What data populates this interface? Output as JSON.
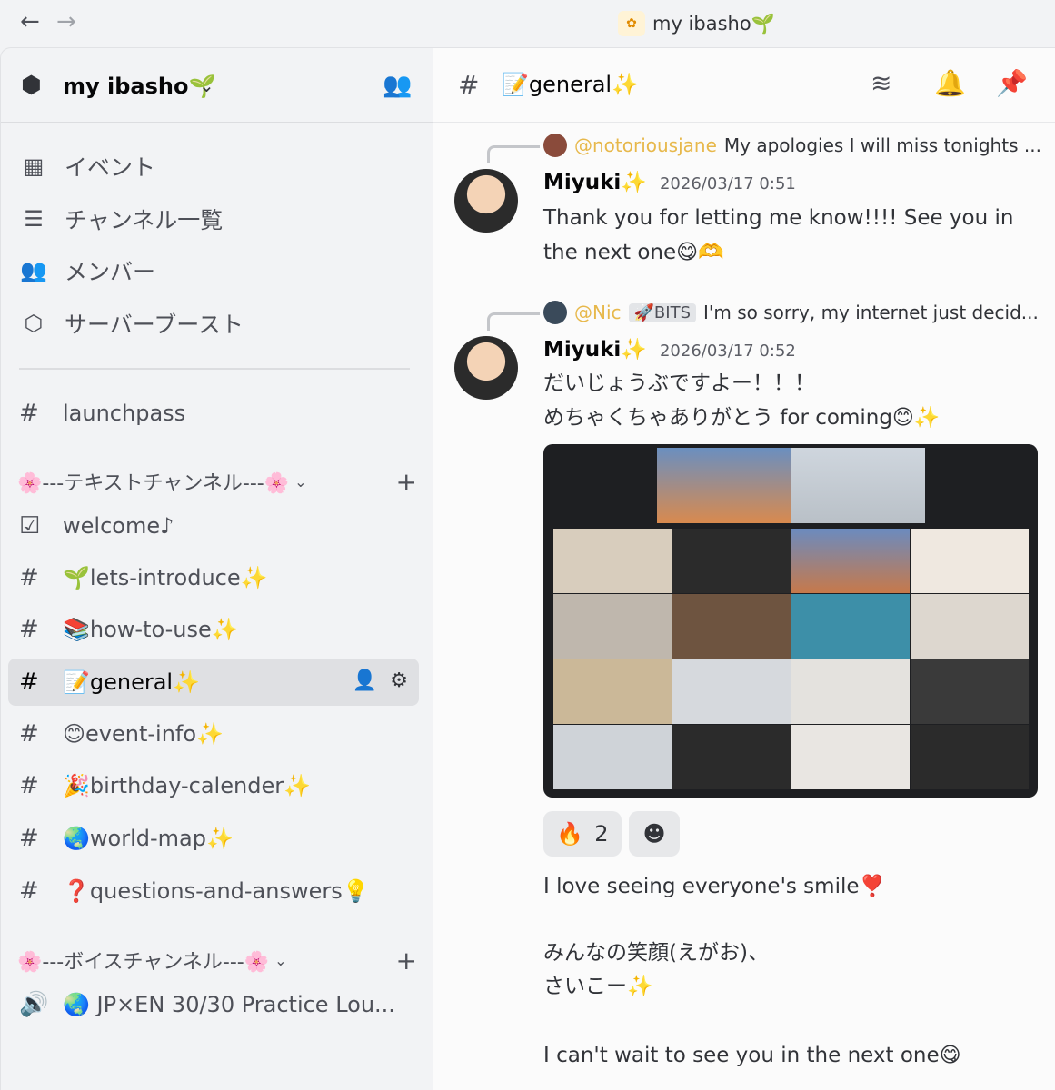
{
  "titlebar": {
    "back_icon": "arrow-left-icon",
    "forward_icon": "arrow-right-icon",
    "app_title": "my ibasho🌱",
    "logo_text": "ibasho"
  },
  "sidebar": {
    "server_name": "my ibasho🌱",
    "menu": [
      {
        "label": "イベント",
        "icon": "calendar-icon"
      },
      {
        "label": "チャンネル一覧",
        "icon": "channel-browse-icon"
      },
      {
        "label": "メンバー",
        "icon": "members-icon"
      },
      {
        "label": "サーバーブースト",
        "icon": "boost-icon"
      }
    ],
    "standalone_channel": "launchpass",
    "text_category": "🌸---テキストチャンネル---🌸",
    "text_channels": [
      {
        "label": "welcome♪",
        "icon": "rules-icon"
      },
      {
        "label": "🌱lets-introduce✨",
        "icon": "hash-lock-icon"
      },
      {
        "label": "📚how-to-use✨",
        "icon": "hash-lock-icon"
      },
      {
        "label": "📝general✨",
        "icon": "hash-lock-icon",
        "selected": true
      },
      {
        "label": "😊event-info✨",
        "icon": "hash-lock-icon"
      },
      {
        "label": "🎉birthday-calender✨",
        "icon": "hash-lock-icon"
      },
      {
        "label": "🌏world-map✨",
        "icon": "hash-lock-icon"
      },
      {
        "label": "❓questions-and-answers💡",
        "icon": "hash-lock-icon"
      }
    ],
    "voice_category": "🌸---ボイスチャンネル---🌸",
    "voice_channels": [
      {
        "label": "🌏 JP×EN 30/30 Practice Lou...",
        "icon": "speaker-lock-icon"
      }
    ]
  },
  "chat": {
    "channel_title": "📝general✨",
    "header_icons": [
      "threads-icon",
      "bell-icon",
      "pin-icon"
    ],
    "messages": [
      {
        "reply_to_name": "@notoriousjane",
        "reply_to_text": "My apologies I will miss tonights ...",
        "author": "Miyuki✨",
        "time": "2026/03/17 0:51",
        "text": "Thank you for letting me know!!!! See you in the next one😋🫶"
      },
      {
        "reply_to_name": "@Nic",
        "reply_badge": "🚀BITS",
        "reply_to_text": "I'm so sorry, my internet just decid...",
        "author": "Miyuki✨",
        "time": "2026/03/17 0:52",
        "text_line1": "だいじょうぶですよー！！！",
        "text_line2": "めちゃくちゃありがとう for coming😊✨",
        "reactions": [
          {
            "emoji": "🔥",
            "count": "2"
          }
        ],
        "add_reaction_icon": "add-reaction-icon",
        "text_after_1": "I love seeing everyone's smile❣️",
        "text_after_2": "みんなの笑顔(えがお)、",
        "text_after_3": "さいこー✨",
        "text_after_4": "I can't wait to see you in the next one😋"
      }
    ]
  },
  "colors": {
    "sidebar_bg": "#f2f3f5",
    "chat_bg": "#fbfbfb",
    "selected_bg": "#dfe0e3",
    "reply_name": "#e7b84b",
    "video_bg": "#1e1f22"
  }
}
